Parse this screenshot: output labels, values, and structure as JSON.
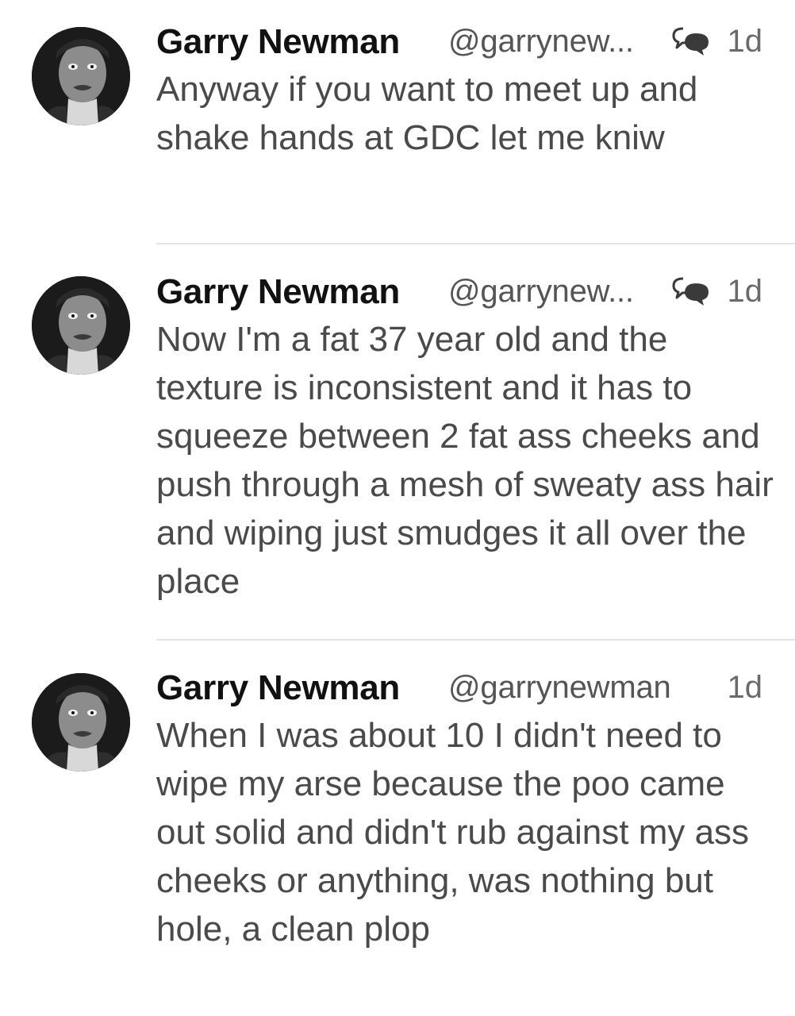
{
  "tweets": [
    {
      "name": "Garry Newman",
      "handle": "@garrynew...",
      "time": "1d",
      "has_reply_icon": true,
      "text": "Anyway if you want to meet up and shake hands at GDC let me kniw"
    },
    {
      "name": "Garry Newman",
      "handle": "@garrynew...",
      "time": "1d",
      "has_reply_icon": true,
      "text": "Now I'm a fat 37 year old and the texture is inconsistent and it has to squeeze between 2 fat ass cheeks and push through a mesh of sweaty ass hair and wiping just smudges it all over the place"
    },
    {
      "name": "Garry Newman",
      "handle": "@garrynewman",
      "time": "1d",
      "has_reply_icon": false,
      "text": "When I was about 10 I didn't need to wipe my arse because the poo came out solid and didn't rub against my ass cheeks or anything, was nothing but hole, a clean plop"
    }
  ],
  "icons": {
    "reply": "conversation-icon",
    "avatar": "avatar-photo"
  },
  "colors": {
    "name": "#111111",
    "handle": "#555555",
    "text": "#4a4a4a",
    "divider": "#e3e3e3",
    "icon": "#3a3a3a"
  }
}
